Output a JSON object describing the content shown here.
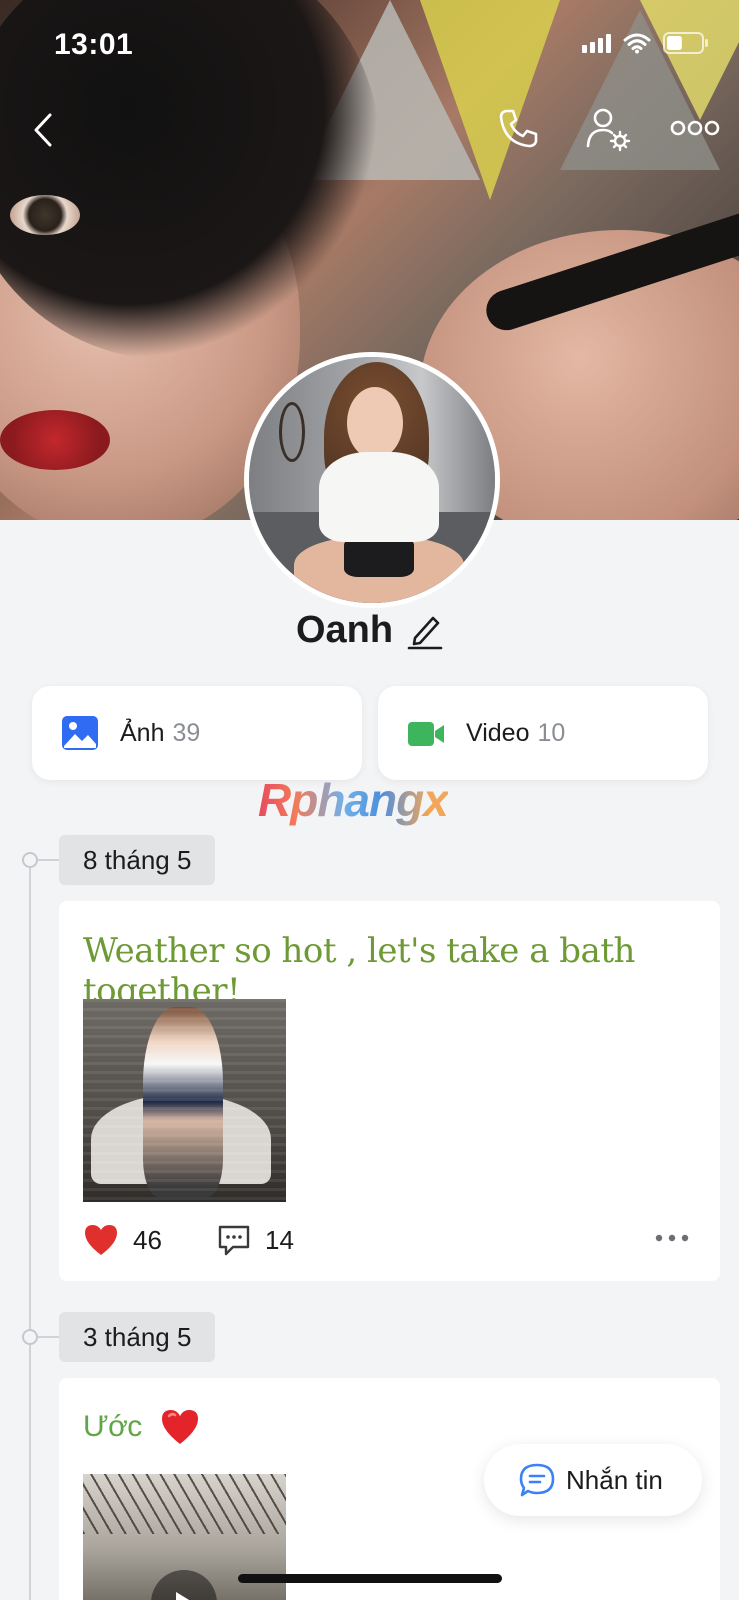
{
  "status_bar": {
    "time": "13:01",
    "battery_level": 0.45
  },
  "nav": {
    "back_icon": "chevron-left-icon",
    "call_icon": "phone-icon",
    "settings_icon": "user-settings-icon",
    "more_icon": "more-horizontal-icon"
  },
  "profile": {
    "name": "Oanh",
    "edit_icon": "pencil-icon"
  },
  "media": {
    "photos": {
      "label": "Ảnh",
      "count": "39",
      "icon": "image-icon",
      "color": "#2f6bf3"
    },
    "videos": {
      "label": "Video",
      "count": "10",
      "icon": "video-camera-icon",
      "color": "#3cb55d"
    }
  },
  "watermark": "Rphangx",
  "timeline": [
    {
      "date": "8 tháng 5",
      "text": "Weather so hot , let's take a bath together!",
      "text_color": "#6e9a35",
      "likes": "46",
      "comments": "14"
    },
    {
      "date": "3 tháng 5",
      "text": "Ước",
      "text_color": "#5ea647",
      "emoji": "heart-emoji",
      "has_video": true
    }
  ],
  "message_button": {
    "label": "Nhắn tin",
    "icon": "chat-bubble-icon",
    "color": "#3b82f6"
  },
  "colors": {
    "like_red": "#e0302e",
    "background": "#f3f4f6"
  }
}
